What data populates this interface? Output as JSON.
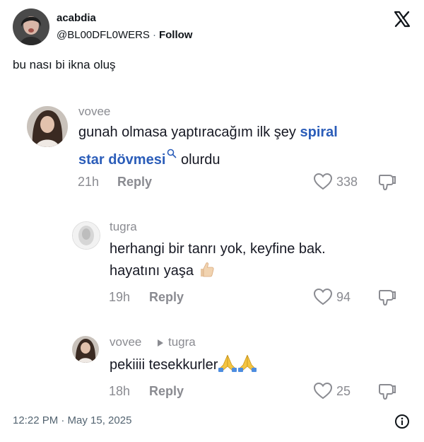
{
  "tweet": {
    "author": {
      "name": "acabdia",
      "handle": "@BL00DFL0WERS",
      "separator": "·",
      "follow_label": "Follow"
    },
    "text": "bu nası bi ikna oluş",
    "timestamp": "12:22 PM · May 15, 2025"
  },
  "screenshot": {
    "comments": [
      {
        "username": "vovee",
        "text_before": "gunah olmasa yaptıracağım ilk şey ",
        "link_line1": "spiral",
        "link_line2": "star dövmesi",
        "text_after": " olurdu",
        "age": "21h",
        "reply_label": "Reply",
        "likes": "338"
      },
      {
        "username": "tugra",
        "line1": "herhangi bir tanrı yok, keyfine bak.",
        "line2": "hayatını yaşa",
        "emoji": "thumbs-up",
        "age": "19h",
        "reply_label": "Reply",
        "likes": "94"
      },
      {
        "username": "vovee",
        "reply_to": "tugra",
        "text": "pekiiii tesekkurler",
        "emoji": "folded-hands-x2",
        "age": "18h",
        "reply_label": "Reply",
        "likes": "25"
      }
    ]
  },
  "colors": {
    "link": "#2b5db9",
    "muted": "#8a8b91",
    "text": "#161823",
    "x_text": "#0f1419",
    "x_muted": "#536471"
  },
  "icons": [
    "x-logo-icon",
    "heart-icon",
    "dislike-icon",
    "search-icon",
    "play-triangle-icon",
    "info-icon"
  ]
}
